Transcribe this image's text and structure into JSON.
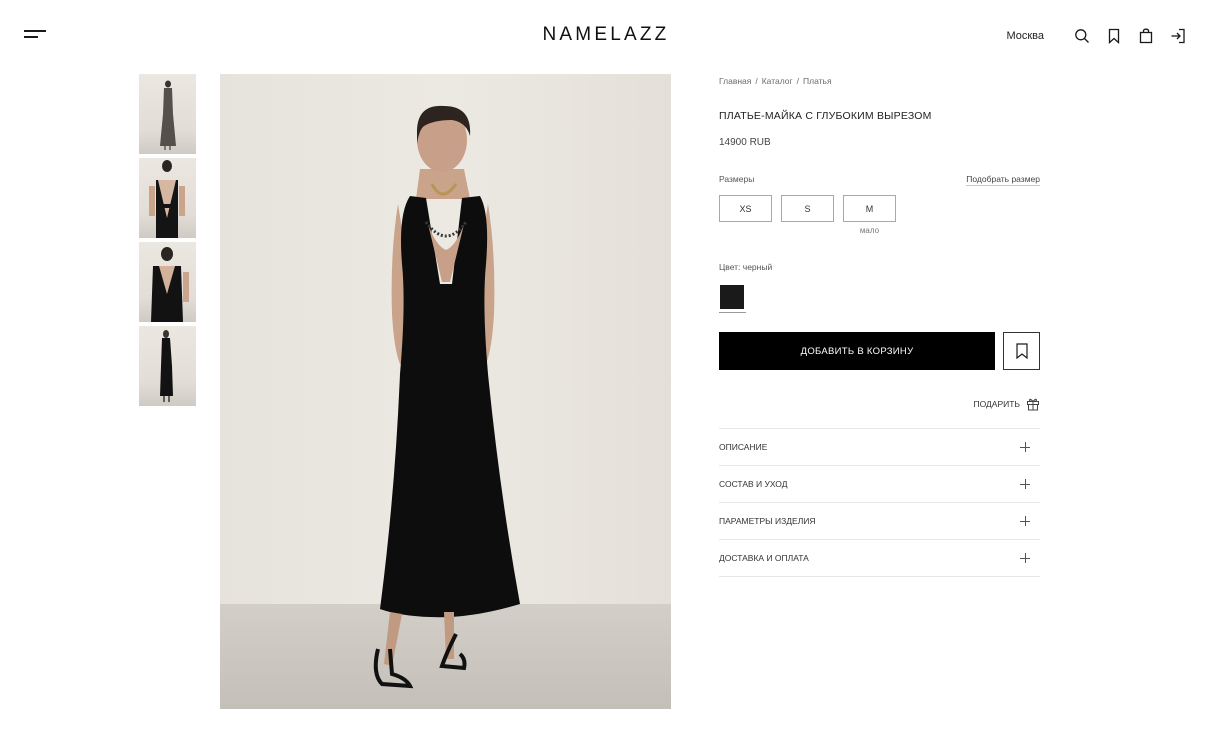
{
  "header": {
    "logo": "NAMELAZZ",
    "city": "Москва",
    "icons": [
      "menu-icon",
      "search-icon",
      "bookmark-icon",
      "shopping-bag-icon",
      "login-icon"
    ]
  },
  "gallery": {
    "thumbnails": [
      "thumb-1",
      "thumb-2",
      "thumb-3",
      "thumb-4"
    ]
  },
  "product": {
    "breadcrumbs": [
      "Главная",
      "Каталог",
      "Платья"
    ],
    "breadcrumb_separator": "/",
    "title": "ПЛАТЬЕ-МАЙКА С ГЛУБОКИМ ВЫРЕЗОМ",
    "price": "14900 RUB",
    "sizes_label": "Размеры",
    "size_guide": "Подобрать размер",
    "sizes": [
      {
        "label": "XS",
        "note": ""
      },
      {
        "label": "S",
        "note": ""
      },
      {
        "label": "M",
        "note": "мало"
      }
    ],
    "color_label": "Цвет: черный",
    "color_swatch": "#1a1a1a",
    "add_to_cart": "ДОБАВИТЬ В КОРЗИНУ",
    "gift": "ПОДАРИТЬ",
    "accordion": [
      "ОПИСАНИЕ",
      "СОСТАВ И УХОД",
      "ПАРАМЕТРЫ ИЗДЕЛИЯ",
      "ДОСТАВКА И ОПЛАТА"
    ]
  }
}
